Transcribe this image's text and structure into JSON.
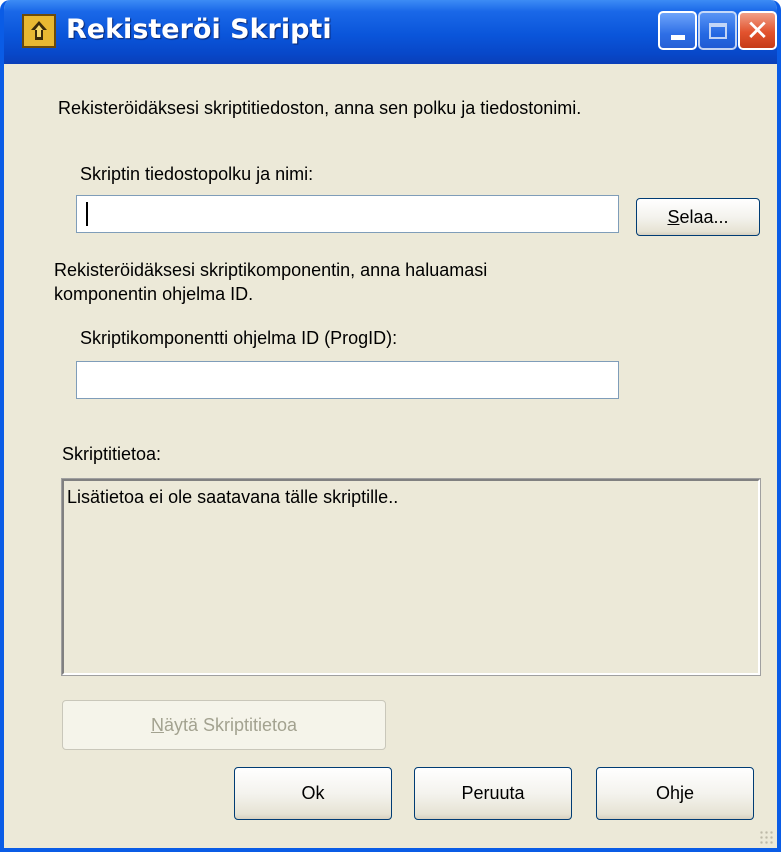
{
  "window": {
    "title": "Rekisteröi Skripti",
    "minimize_icon": "minimize-icon",
    "maximize_icon": "maximize-icon",
    "close_icon": "close-icon"
  },
  "intro_text": "Rekisteröidäksesi skriptitiedoston, anna sen polku ja tiedostonimi.",
  "path_field": {
    "label": "Skriptin tiedostopolku ja nimi:",
    "value": "",
    "browse_button": {
      "mnemonic": "S",
      "rest": "elaa..."
    }
  },
  "component_text": {
    "line1": "Rekisteröidäksesi skriptikomponentin, anna haluamasi",
    "line2": "komponentin ohjelma ID."
  },
  "progid_field": {
    "label": "Skriptikomponentti ohjelma ID (ProgID):",
    "value": ""
  },
  "info": {
    "label": "Skriptitietoa:",
    "content": "Lisätietoa ei ole saatavana tälle skriptille.."
  },
  "buttons": {
    "show_info": {
      "mnemonic": "N",
      "rest": "äytä Skriptitietoa"
    },
    "ok": "Ok",
    "cancel": "Peruuta",
    "help": "Ohje"
  },
  "colors": {
    "titlebar": "#0A55DA",
    "window_bg": "#ECE9D8",
    "field_border": "#7F9DB9",
    "button_border": "#003C74"
  }
}
